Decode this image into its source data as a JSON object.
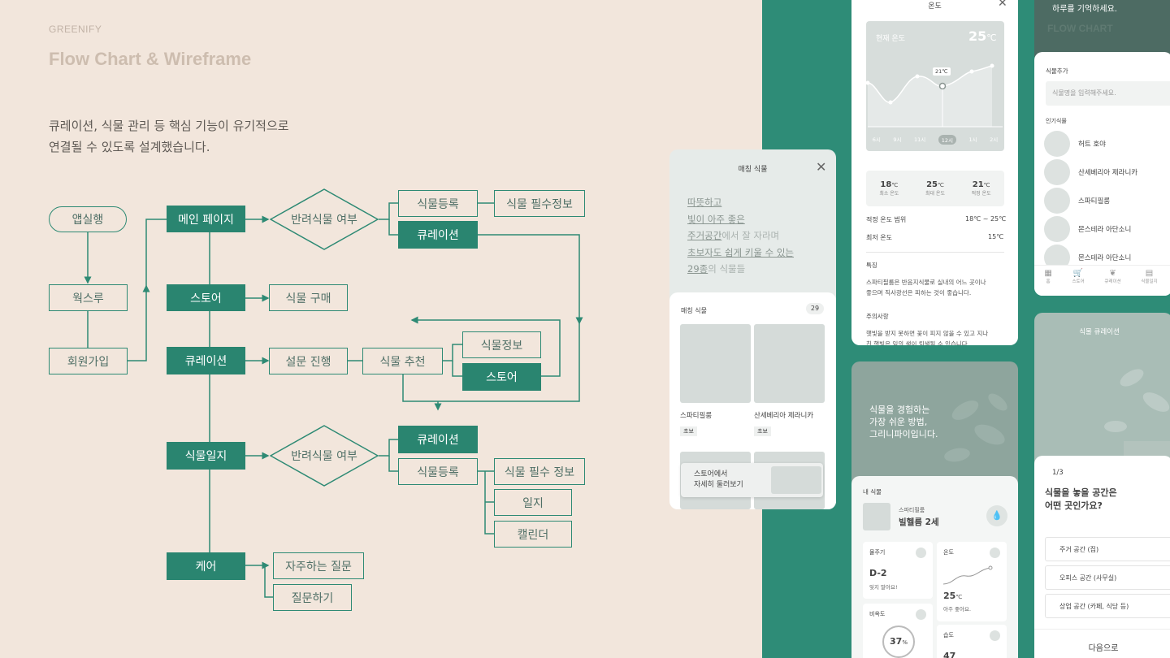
{
  "brand": "GREENIFY",
  "title": "Flow Chart & Wireframe",
  "description": [
    "큐레이션, 식물 관리 등 핵심 기능이 유기적으로",
    "연결될 수 있도록 설계했습니다."
  ],
  "flow": {
    "app_start": "앱실행",
    "walkthrough": "웍스루",
    "signup": "회원가입",
    "main_page": "메인 페이지",
    "pet_plant_q1": "반려식물 여부",
    "plant_register_1": "식물등록",
    "plant_required_info_1": "식물 필수정보",
    "curation_1": "큐레이션",
    "store": "스토어",
    "plant_purchase": "식물 구매",
    "curation_main": "큐레이션",
    "survey": "설문 진행",
    "plant_recommend": "식물 추천",
    "plant_info": "식물정보",
    "store_2": "스토어",
    "plant_diary": "식물일지",
    "pet_plant_q2": "반려식물 여부",
    "curation_2": "큐레이션",
    "plant_register_2": "식물등록",
    "plant_required_info_2": "식물 필수 정보",
    "diary": "일지",
    "calendar": "캘린더",
    "care": "케어",
    "faq": "자주하는 질문",
    "ask": "질문하기"
  },
  "matching_card": {
    "header": "매칭 식물",
    "lines": [
      "따뜻하고",
      "빛이 아주 좋은",
      "주거공간",
      "에서 잘 자라며",
      "초보자도 쉽게 키울 수 있는",
      "29종",
      "의 식물들"
    ],
    "list_title": "매칭 식물",
    "count": "29",
    "items": [
      {
        "name": "스파티필룸",
        "tag": "초보"
      },
      {
        "name": "산세베리아 제라니카",
        "tag": "초보"
      }
    ],
    "cta": [
      "스토어에서",
      "자세히 둘러보기"
    ]
  },
  "temp_card": {
    "header": "온도",
    "current_label": "현재 온도",
    "current_value": "25",
    "unit": "℃",
    "tooltip": "21℃",
    "x_ticks": [
      "6시",
      "9시",
      "11시",
      "12시",
      "1시",
      "2시"
    ],
    "stats": [
      {
        "value": "18",
        "label": "최소 온도"
      },
      {
        "value": "25",
        "label": "최대 온도"
      },
      {
        "value": "21",
        "label": "적정 온도"
      }
    ],
    "range_label": "적정 온도 범위",
    "range_value": "18℃ ~ 25℃",
    "min_label": "최저 온도",
    "min_value": "15℃",
    "feature_label": "특징",
    "feature_text": [
      "스파티필룸은 반음지식물로 실내의 어느 곳이나",
      "좋으며 직사광선은 피하는 것이 좋습니다."
    ],
    "caution_label": "주의사항",
    "caution_text": [
      "햇빛을 받지 못하면 꽃이 피지 않을 수 있고 지나",
      "친 햇빛은 잎의 색이 퇴색될 수 있습니다."
    ]
  },
  "intro_card": {
    "text": [
      "식물을 경험하는",
      "가장 쉬운 방법,",
      "그리니파이입니다."
    ]
  },
  "my_plant_card": {
    "header": "내 식물",
    "species": "스파티필룸",
    "nickname": "빌헬름 2세",
    "water_label": "물주기",
    "water_value": "D-2",
    "water_note": "잊지 말아요!",
    "temp_label": "온도",
    "temp_value": "25",
    "temp_unit": "℃",
    "temp_note": "아주 좋아요.",
    "fert_label": "비옥도",
    "fert_value": "37",
    "fert_unit": "%",
    "humid_label": "습도",
    "humid_value": "47"
  },
  "top_right": {
    "text": "하루를 기억하세요.",
    "watermark": "FLOW CHART"
  },
  "add_plant_card": {
    "header": "식물추가",
    "placeholder": "식물명을 입력해주세요.",
    "popular_label": "인기식물",
    "plants": [
      "허트 호야",
      "산세베리아 제라니카",
      "스파티필룸",
      "몬스테라 아단소니",
      "몬스테라 아단소니"
    ],
    "nav": [
      "홈",
      "스토어",
      "큐레이션",
      "식물일지"
    ]
  },
  "curation_card": {
    "header": "식물 큐레이션",
    "step": "1/3",
    "question": [
      "식물을 놓을 공간은",
      "어떤 곳인가요?"
    ],
    "options": [
      "주거 공간 (집)",
      "오피스 공간 (사무실)",
      "상업 공간 (카페, 식당 등)"
    ],
    "next": "다음으로"
  },
  "colors": {
    "accent": "#2a8570",
    "background": "#f2e6dc",
    "panel": "#2e8c77"
  }
}
